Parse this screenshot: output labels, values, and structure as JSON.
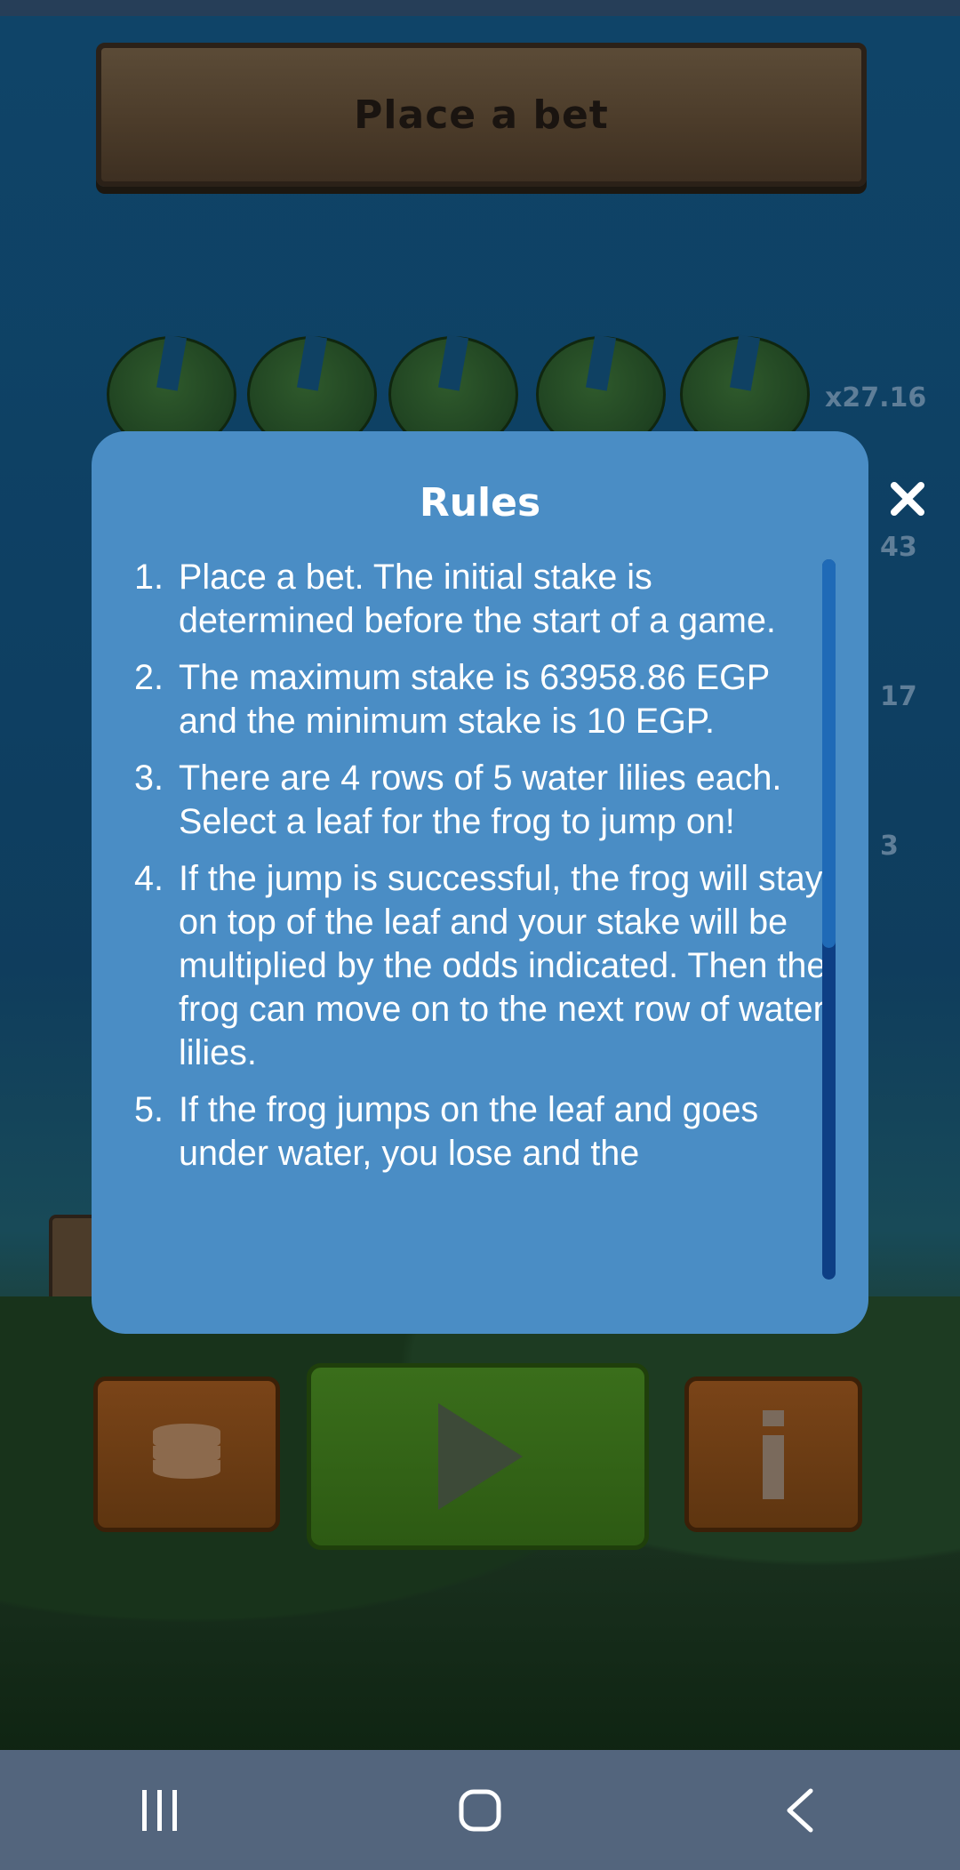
{
  "game": {
    "header_label": "Place a bet",
    "multipliers": [
      "x27.16",
      "43",
      "17",
      "3"
    ]
  },
  "modal": {
    "title": "Rules",
    "close_icon": "close-icon",
    "rules": [
      {
        "num": "1.",
        "text": "Place a bet. The initial stake is determined before the start of a game."
      },
      {
        "num": "2.",
        "text": "The maximum stake is 63958.86 EGP and the minimum stake is 10 EGP."
      },
      {
        "num": "3.",
        "text": "There are 4 rows of 5 water lilies each. Select a leaf for the frog to jump on!"
      },
      {
        "num": "4.",
        "text": "If the jump is successful, the frog will stay on top of the leaf and your stake will be multiplied by the odds indicated. Then the frog can move on to the next row of water lilies."
      },
      {
        "num": "5.",
        "text": "If the frog jumps on the leaf and goes under water, you lose and the"
      }
    ],
    "scroll_fraction": 0.54
  },
  "controls": {
    "bet_icon": "coins-icon",
    "play_icon": "play-icon",
    "info_icon": "info-icon"
  },
  "nav": {
    "recents_icon": "recents-icon",
    "home_icon": "home-icon",
    "back_icon": "back-icon"
  },
  "colors": {
    "modal_bg": "#4a8dc5",
    "scroll_track": "#0d3f85",
    "scroll_thumb": "#1f6ab7",
    "nav_bg": "#53657d"
  }
}
